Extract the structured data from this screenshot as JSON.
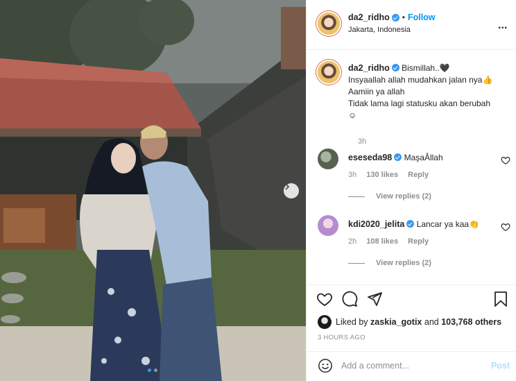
{
  "header": {
    "username": "da2_ridho",
    "separator": "•",
    "follow_label": "Follow",
    "location": "Jakarta, Indonesia",
    "more_label": "..."
  },
  "caption": {
    "username": "da2_ridho",
    "lines": [
      "Bismillah..🖤",
      "Insyaallah allah mudahkan jalan nya👍",
      "Aamiin ya allah",
      "Tidak lama lagi statusku akan berubah",
      "☺"
    ],
    "time": "3h"
  },
  "comments": [
    {
      "username": "eseseda98",
      "text": "MaşaÂllah",
      "time": "3h",
      "likes": "130 likes",
      "reply_label": "Reply",
      "view_replies": "View replies (2)"
    },
    {
      "username": "kdi2020_jelita",
      "text": "Lancar ya kaa👏",
      "time": "2h",
      "likes": "108 likes",
      "reply_label": "Reply",
      "view_replies": "View replies (2)"
    }
  ],
  "likes": {
    "prefix": "Liked by",
    "user": "zaskia_gotix",
    "middle": "and",
    "others": "103,768 others"
  },
  "timeago": "3 HOURS AGO",
  "add_comment": {
    "placeholder": "Add a comment...",
    "post_label": "Post"
  },
  "carousel": {
    "slide_count": 2,
    "active_index": 0
  },
  "colors": {
    "link_blue": "#0095f6",
    "verified_blue": "#3897f0",
    "muted_text": "#8e8e8e",
    "post_disabled": "#b2dffc"
  },
  "icons": {
    "next": "chevron-right-icon",
    "like": "heart-icon",
    "comment": "comment-icon",
    "share": "paper-plane-icon",
    "save": "bookmark-icon",
    "emoji": "smiley-icon",
    "verified": "verified-badge-icon",
    "more": "more-options-icon"
  }
}
